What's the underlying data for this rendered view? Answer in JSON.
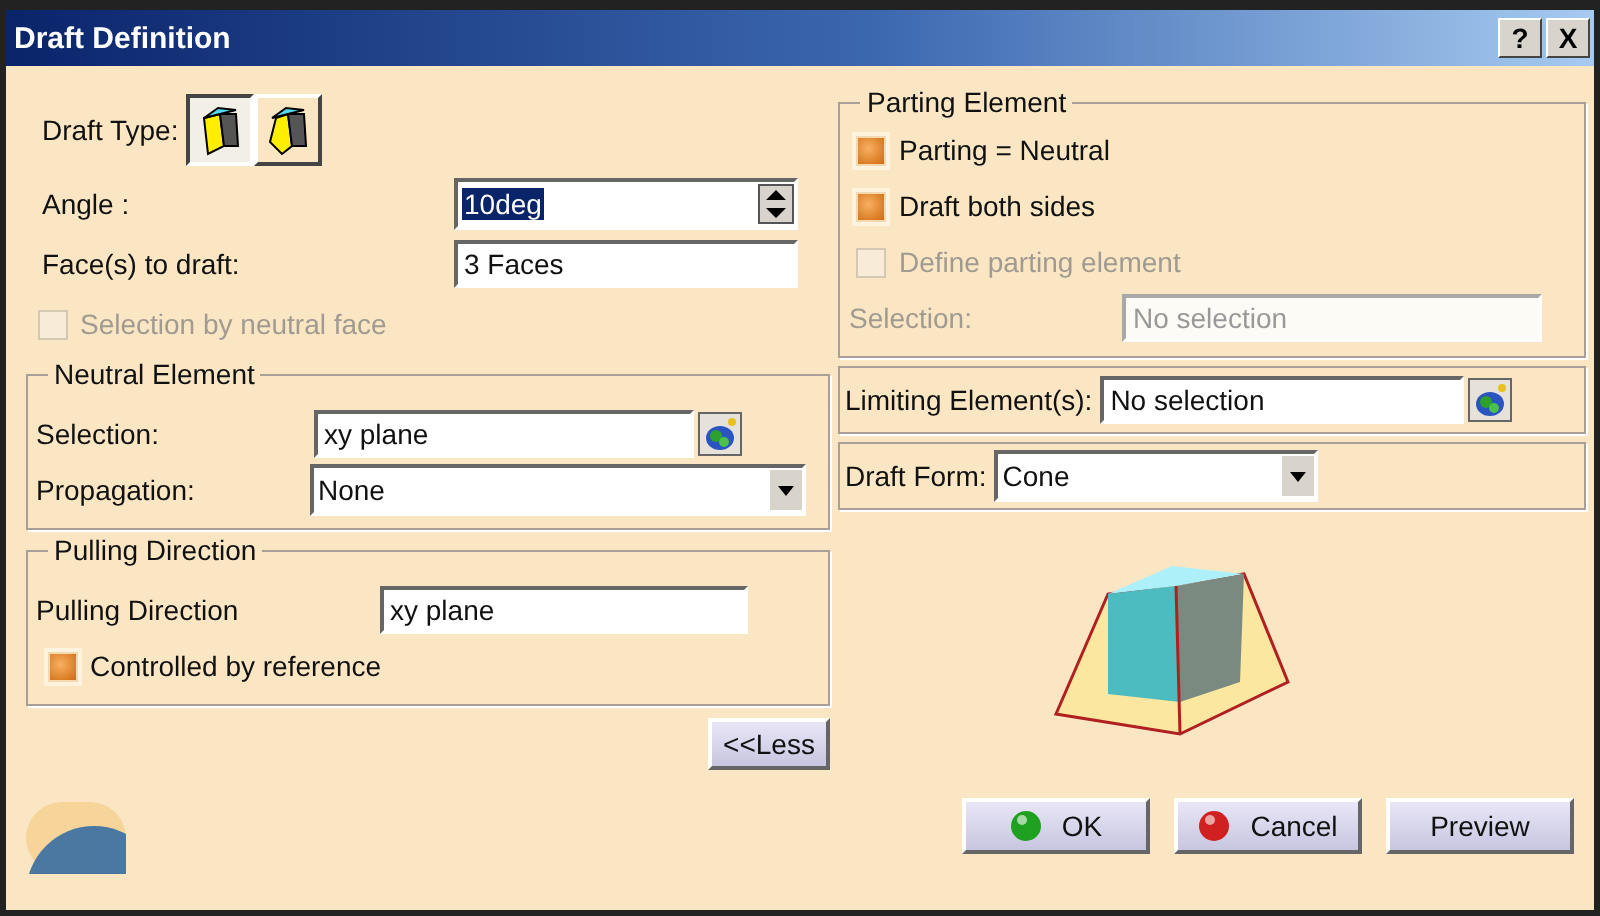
{
  "window": {
    "title": "Draft Definition",
    "title_buttons": [
      "?",
      "X"
    ]
  },
  "draft_type": {
    "label": "Draft Type:",
    "options": [
      {
        "selected": true
      },
      {
        "selected": false
      }
    ]
  },
  "angle": {
    "label": "Angle :",
    "value": "10deg"
  },
  "faces": {
    "label": "Face(s) to draft:",
    "value": "3 Faces"
  },
  "neutral_face_option": {
    "label": "Selection by neutral face",
    "checked": false,
    "disabled": true
  },
  "neutral_element": {
    "title": "Neutral Element",
    "selection_label": "Selection:",
    "selection_value": "xy plane",
    "propagation_label": "Propagation:",
    "propagation_value": "None"
  },
  "pulling_direction": {
    "title": "Pulling Direction",
    "label": "Pulling Direction",
    "value": "xy plane",
    "option": {
      "label": "Controlled by reference",
      "checked": true,
      "disabled": false
    }
  },
  "less_button": "<<Less",
  "parting_element": {
    "title": "Parting Element",
    "options": [
      {
        "label": "Parting = Neutral",
        "checked": true,
        "disabled": false
      },
      {
        "label": "Draft both sides",
        "checked": true,
        "disabled": false
      },
      {
        "label": "Define parting element",
        "checked": false,
        "disabled": true
      }
    ],
    "selection_label": "Selection:",
    "selection_placeholder": "No selection",
    "selection_disabled": true
  },
  "limiting_elements": {
    "label": "Limiting Element(s):",
    "value": "No selection"
  },
  "draft_form": {
    "label": "Draft Form:",
    "value": "Cone"
  },
  "buttons": [
    {
      "kind": "ok",
      "label": "OK"
    },
    {
      "kind": "cancel",
      "label": "Cancel"
    },
    {
      "kind": "plain",
      "label": "Preview"
    }
  ]
}
